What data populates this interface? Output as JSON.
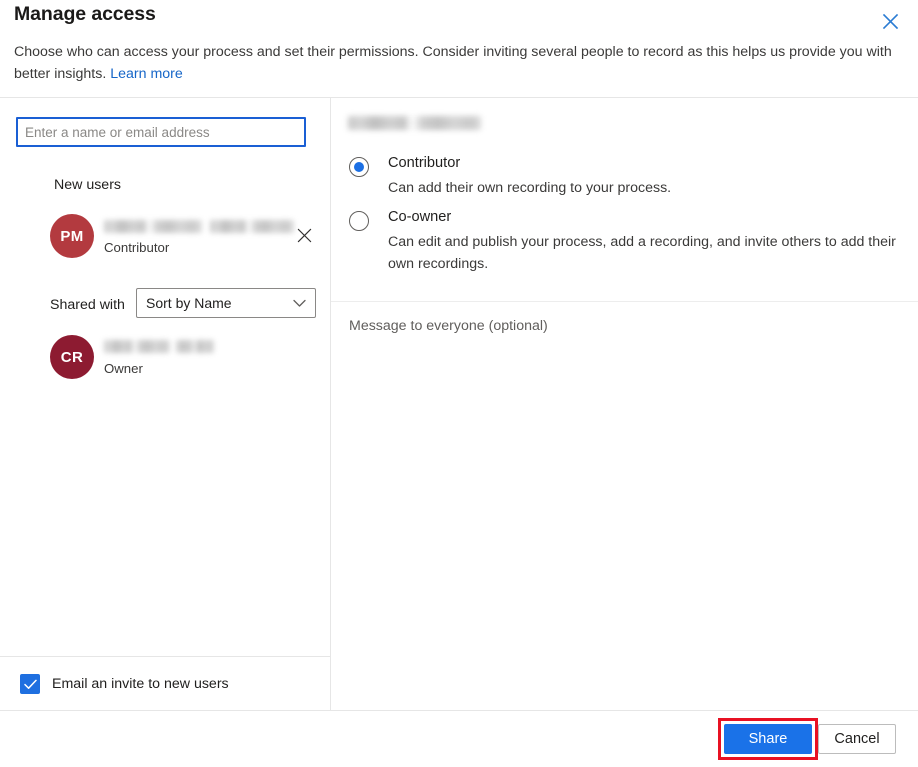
{
  "header": {
    "title": "Manage access",
    "subtitle_part1": "Choose who can access your process and set their permissions. Consider inviting several people to record as this helps us provide you with better insights. ",
    "learn_more_label": "Learn more",
    "close_icon": "close-icon"
  },
  "left_panel": {
    "search": {
      "placeholder": "Enter a name or email address",
      "value": ""
    },
    "new_users_label": "New users",
    "new_users": [
      {
        "initials": "PM",
        "name": "",
        "role": "Contributor",
        "remove_icon": "close-icon"
      }
    ],
    "shared_with_label": "Shared with",
    "sort": {
      "selected": "Sort by Name",
      "options": [
        "Sort by Name"
      ],
      "chevron_icon": "chevron-down-icon"
    },
    "shared_users": [
      {
        "initials": "CR",
        "name": "",
        "role": "Owner"
      }
    ],
    "email_invite": {
      "label": "Email an invite to new users",
      "checked": true,
      "check_icon": "checkmark-icon"
    }
  },
  "right_panel": {
    "target_name": "",
    "permissions": [
      {
        "id": "contributor",
        "label": "Contributor",
        "description": "Can add their own recording to your process.",
        "selected": true
      },
      {
        "id": "co-owner",
        "label": "Co-owner",
        "description": "Can edit and publish your process, add a recording, and invite others to add their own recordings.",
        "selected": false
      }
    ],
    "message": {
      "placeholder": "Message to everyone (optional)",
      "value": ""
    }
  },
  "footer": {
    "share_label": "Share",
    "cancel_label": "Cancel"
  },
  "colors": {
    "accent_blue": "#1a72e8",
    "link_blue": "#1666c8",
    "focus_blue": "#1a5fd4",
    "avatar_new_user": "#b33a3f",
    "avatar_owner": "#8d1b31",
    "highlight_red": "#e81123",
    "checkbox_blue": "#1e6fe0"
  }
}
